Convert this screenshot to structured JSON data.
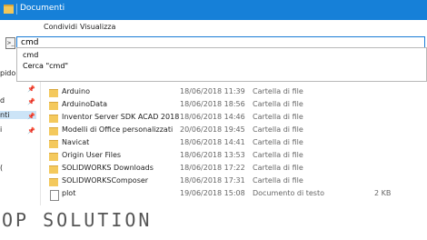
{
  "window": {
    "title": "Documenti",
    "accent": "#1680d8"
  },
  "ribbon": {
    "tabs": [
      "Condividi",
      "Visualizza"
    ]
  },
  "address": {
    "value": "cmd"
  },
  "suggestions": [
    "cmd",
    "Cerca \"cmd\""
  ],
  "nav": {
    "items": [
      "pido",
      "d",
      "nti",
      "i",
      "("
    ]
  },
  "files": [
    {
      "name": "Arduino",
      "date": "18/06/2018 11:39",
      "type": "Cartella di file",
      "size": "",
      "icon": "folder-icon"
    },
    {
      "name": "ArduinoData",
      "date": "18/06/2018 18:56",
      "type": "Cartella di file",
      "size": "",
      "icon": "folder-icon"
    },
    {
      "name": "Inventor Server SDK ACAD 2018",
      "date": "18/06/2018 14:46",
      "type": "Cartella di file",
      "size": "",
      "icon": "folder-icon"
    },
    {
      "name": "Modelli di Office personalizzati",
      "date": "20/06/2018 19:45",
      "type": "Cartella di file",
      "size": "",
      "icon": "folder-icon"
    },
    {
      "name": "Navicat",
      "date": "18/06/2018 14:41",
      "type": "Cartella di file",
      "size": "",
      "icon": "folder-icon"
    },
    {
      "name": "Origin User Files",
      "date": "18/06/2018 13:53",
      "type": "Cartella di file",
      "size": "",
      "icon": "folder-icon"
    },
    {
      "name": "SOLIDWORKS Downloads",
      "date": "18/06/2018 17:22",
      "type": "Cartella di file",
      "size": "",
      "icon": "folder-icon"
    },
    {
      "name": "SOLIDWORKSComposer",
      "date": "18/06/2018 17:31",
      "type": "Cartella di file",
      "size": "",
      "icon": "folder-icon"
    },
    {
      "name": "plot",
      "date": "19/06/2018 15:08",
      "type": "Documento di testo",
      "size": "2 KB",
      "icon": "text-file-icon"
    }
  ],
  "watermark": "OP SOLUTION"
}
